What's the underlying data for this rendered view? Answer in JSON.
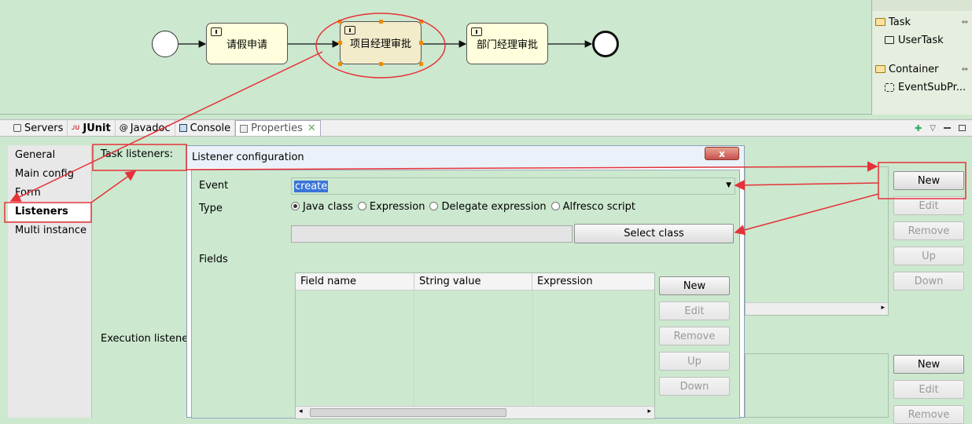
{
  "diagram": {
    "tasks": [
      {
        "label": "请假申请"
      },
      {
        "label": "项目经理审批"
      },
      {
        "label": "部门经理审批"
      }
    ]
  },
  "palette": {
    "groups": [
      {
        "label": "Task",
        "item": "UserTask"
      },
      {
        "label": "Container",
        "item": "EventSubPr..."
      }
    ]
  },
  "tabs": [
    "Servers",
    "JUnit",
    "Javadoc",
    "Console",
    "Properties"
  ],
  "sidebar": {
    "items": [
      "General",
      "Main config",
      "Form",
      "Listeners",
      "Multi instance"
    ],
    "selected": "Listeners"
  },
  "properties": {
    "task_listeners_label": "Task listeners:",
    "execution_listeners_label": "Execution listeners:",
    "task_buttons": [
      "New",
      "Edit",
      "Remove",
      "Up",
      "Down"
    ],
    "exec_buttons": [
      "New",
      "Edit",
      "Remove"
    ]
  },
  "dialog": {
    "title": "Listener configuration",
    "close_label": "x",
    "event_label": "Event",
    "event_value": "create",
    "type_label": "Type",
    "type_options": [
      "Java class",
      "Expression",
      "Delegate expression",
      "Alfresco script"
    ],
    "type_selected": "Java class",
    "select_class_label": "Select class",
    "fields_label": "Fields",
    "columns": [
      "Field name",
      "String value",
      "Expression"
    ],
    "field_buttons": [
      "New",
      "Edit",
      "Remove",
      "Up",
      "Down"
    ]
  },
  "colors": {
    "highlight": "#e53238",
    "panel_bg": "#cce8cf"
  }
}
